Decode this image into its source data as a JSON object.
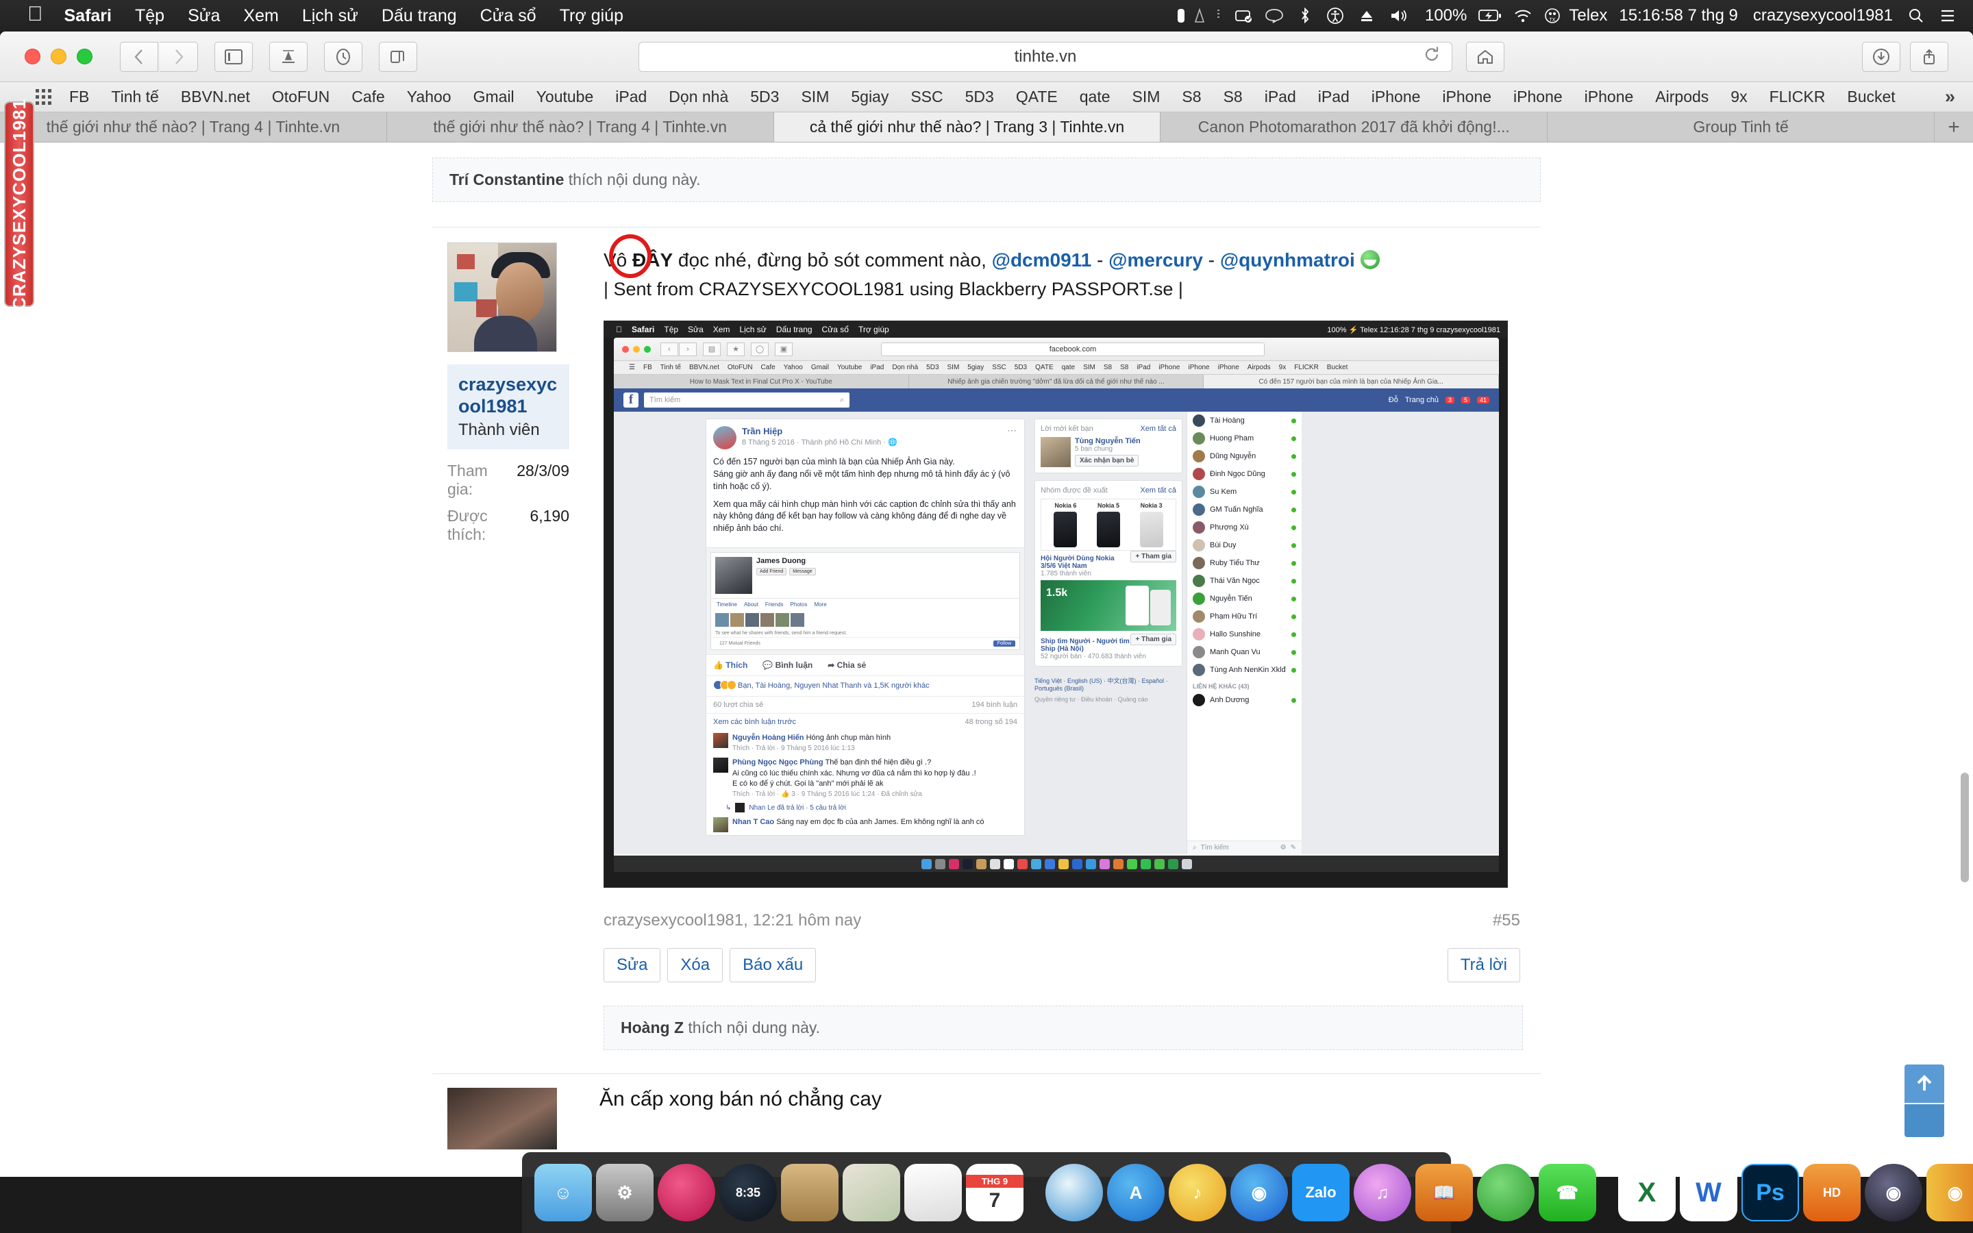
{
  "menubar": {
    "apple": "apple-logo",
    "items": [
      "Safari",
      "Tệp",
      "Sửa",
      "Xem",
      "Lịch sử",
      "Dấu trang",
      "Cửa sổ",
      "Trợ giúp"
    ],
    "battery_percent": "100%",
    "input_source": "Telex",
    "clock": "15:16:58 7 thg 9",
    "user": "crazysexycool1981",
    "right_icons": [
      "lock-icon",
      "signal-icon",
      "notes-icon",
      "chat-icon",
      "bluetooth-icon",
      "accessibility-icon",
      "eject-icon",
      "volume-icon",
      "battery-icon",
      "wifi-icon",
      "keyboard-icon",
      "search-icon",
      "control-center-icon"
    ]
  },
  "toolbar": {
    "url": "tinhte.vn",
    "icons": [
      "back-icon",
      "forward-icon",
      "sidebar-icon",
      "reading-list-icon",
      "history-icon",
      "tabs-icon",
      "reload-icon",
      "download-icon",
      "share-icon",
      "home-icon"
    ]
  },
  "bookmarks": [
    "FB",
    "Tinh tế",
    "BBVN.net",
    "OtoFUN",
    "Cafe",
    "Yahoo",
    "Gmail",
    "Youtube",
    "iPad",
    "Dọn nhà",
    "5D3",
    "SIM",
    "5giay",
    "SSC",
    "5D3",
    "QATE",
    "qate",
    "SIM",
    "S8",
    "S8",
    "iPad",
    "iPad",
    "iPhone",
    "iPhone",
    "iPhone",
    "iPhone",
    "Airpods",
    "9x",
    "FLICKR",
    "Bucket"
  ],
  "bookmarks_overflow": "»",
  "tabs": [
    {
      "label": "thế giới như thế nào? | Trang 4 | Tinhte.vn",
      "active": false
    },
    {
      "label": "thế giới như thế nào? | Trang 4 | Tinhte.vn",
      "active": false
    },
    {
      "label": "cả thế giới như thế nào? | Trang 3 | Tinhte.vn",
      "active": true
    },
    {
      "label": "Canon Photomarathon 2017 đã khởi động!...",
      "active": false
    },
    {
      "label": "Group Tinh tế",
      "active": false
    }
  ],
  "tab_add": "+",
  "sidetab": {
    "label": "CRAZYSEXYCOOL1981"
  },
  "page": {
    "like_notice_top": {
      "user": "Trí Constantine",
      "text": " thích nội dung này."
    },
    "post": {
      "author": "crazysexycool1981",
      "role": "Thành viên",
      "stats": [
        {
          "key": "Tham gia:",
          "value": "28/3/09"
        },
        {
          "key": "Được thích:",
          "value": "6,190"
        }
      ],
      "text_before": "Vô ",
      "text_highlight": "ĐÂY",
      "text_after": " đọc nhé, đừng bỏ sót comment nào, ",
      "mentions": [
        "@dcm0911",
        "@mercury",
        "@quynhmatroi"
      ],
      "mention_sep": " - ",
      "signature": "| Sent from CRAZYSEXYCOOL1981 using Blackberry PASSPORT.se |",
      "meta_left": "crazysexycool1981, 12:21 hôm nay",
      "meta_right": "#55",
      "buttons_left": [
        "Sửa",
        "Xóa",
        "Báo xấu"
      ],
      "button_right": "Trả lời"
    },
    "like_notice_bottom": {
      "user": "Hoàng Z",
      "text": " thích nội dung này."
    },
    "next_post_title": "Ăn cấp xong bán nó chẳng cay"
  },
  "embedded": {
    "menubar_items": [
      "Safari",
      "Tệp",
      "Sửa",
      "Xem",
      "Lịch sử",
      "Dấu trang",
      "Cửa sổ",
      "Trợ giúp"
    ],
    "menubar_right": "100% ⚡   Telex   12:16:28 7 thg 9   crazysexycool1981",
    "url": "facebook.com",
    "bookmarks": [
      "FB",
      "Tinh tế",
      "BBVN.net",
      "OtoFUN",
      "Cafe",
      "Yahoo",
      "Gmail",
      "Youtube",
      "iPad",
      "Dọn nhà",
      "5D3",
      "SIM",
      "5giay",
      "SSC",
      "5D3",
      "QATE",
      "qate",
      "SIM",
      "S8",
      "S8",
      "iPad",
      "iPhone",
      "iPhone",
      "iPhone",
      "Airpods",
      "9x",
      "FLICKR",
      "Bucket"
    ],
    "tabs": [
      "How to Mask Text in Final Cut Pro X - YouTube",
      "Nhiếp ảnh gia chiến trường \"dởm\" đã lừa dối cả thế giới như thế nào ...",
      "Có đến 157 người bạn của mình là bạn của Nhiếp Ảnh Gia..."
    ],
    "fb_search_placeholder": "Tìm kiếm",
    "fb_nav_right": [
      "Đỗ",
      "Trang chủ"
    ],
    "post": {
      "author": "Trần Hiệp",
      "meta": "8 Tháng 5 2016 · Thành phố Hồ Chí Minh · 🌐",
      "paragraphs": [
        "Có đến 157 người bạn của mình là bạn của Nhiếp Ảnh Gia này.\nSáng giờ anh ấy đang nổi về một tấm hình đẹp nhưng mô tả hình đẩy ác ý (vô tình hoặc cố ý).",
        "Xem qua mấy cái hình chụp màn hình với các caption đc chỉnh sửa thì thấy anh này không đáng để kết bạn hay follow và càng không đáng để đi nghe day về nhiếp ảnh báo chí."
      ],
      "inner_name": "James Duong",
      "inner_buttons": [
        "Add Friend",
        "Message"
      ],
      "inner_tabs": [
        "Timeline",
        "About",
        "Friends",
        "Photos",
        "More"
      ],
      "inner_note": "To see what he shares with friends, send him a friend request.",
      "inner_friends": "127 Mutual Friends",
      "inner_follow": "Follow",
      "actions": [
        "Thích",
        "Bình luận",
        "Chia sẻ"
      ],
      "reactions": "Bạn, Tài Hoàng, Nguyen Nhat Thanh và 1,5K người khác",
      "shares": "60 lượt chia sẻ",
      "comments_count": "194 bình luận",
      "see_prev": "Xem các bình luận trước",
      "comment_range": "48 trong số 194",
      "comments": [
        {
          "name": "Nguyễn Hoàng Hiển",
          "text": "Hóng ảnh chụp màn hình",
          "meta": "Thích · Trả lời · 9 Tháng 5 2016 lúc 1:13"
        },
        {
          "name": "Phùng Ngọc Ngọc Phùng",
          "text": "Thế bạn định thể hiện điều gì .?\nAi cũng có lúc thiếu chính xác. Nhưng vơ đũa cả nắm thì ko hợp lý đâu .!\nE có ko để ý chút. Gọi là \"anh\" mới phải lẽ ak",
          "meta": "Thích · Trả lời · 👍 3 · 9 Tháng 5 2016 lúc 1:24 · Đã chỉnh sửa",
          "reply": "Nhan Le đã trả lời · 5 câu trả lời"
        },
        {
          "name": "Nhan T Cao",
          "text": "Sáng nay em đọc fb của anh James. Em không nghĩ là anh có",
          "meta": ""
        }
      ]
    },
    "right_rail": {
      "friend_request_title": "Lời mời kết bạn",
      "see_all": "Xem tất cả",
      "friend_name": "Tùng Nguyễn Tiến",
      "friend_mutual": "5 bạn chung",
      "friend_button": "Xác nhận bạn bè",
      "groups_title": "Nhóm được đề xuất",
      "nokia": [
        "Nokia 6",
        "Nokia 5",
        "Nokia 3"
      ],
      "group1_name": "Hội Người Dùng Nokia 3/5/6 Việt Nam",
      "group1_meta": "1.785 thành viên",
      "group_join": "+ Tham gia",
      "group2_name": "Ship tìm Người - Người tìm Ship (Hà Nội)",
      "group2_meta": "52 người bán · 470.683 thành viên",
      "promo_label": "1.5k",
      "languages": "Tiếng Việt · English (US) · 中文(台灣) · Español · Português (Brasil)",
      "privacy": "Quyền riêng tư · Điều khoản · Quảng cáo"
    },
    "chat": {
      "contacts": [
        "Tài Hoàng",
        "Huong Pham",
        "Dũng Nguyễn",
        "Đinh Ngọc Dũng",
        "Su Kem",
        "GM Tuấn Nghĩa",
        "Phượng Xù",
        "Bùi Duy",
        "Ruby Tiểu Thư",
        "Thái Văn Ngọc",
        "Nguyễn Tiến",
        "Phạm Hữu Trí",
        "Hallo Sunshine",
        "Manh Quan Vu",
        "Tùng Anh NenKin Xklđ"
      ],
      "other_header": "LIÊN HỆ KHÁC (43)",
      "other_contacts": [
        "Anh Dương"
      ],
      "search_placeholder": "Tìm kiếm"
    }
  },
  "dock": {
    "left_apps": [
      "finder-icon",
      "system-preferences-icon",
      "lastpass-icon",
      "clock-widget-icon",
      "contacts-icon",
      "maps-icon",
      "notes-icon",
      "calendar-icon"
    ],
    "calendar_month": "THG 9",
    "calendar_day": "7",
    "mid_apps": [
      "safari-icon",
      "app-store-icon",
      "itunes-match-icon",
      "photos-pro-icon",
      "zalo-icon",
      "itunes-icon",
      "ibooks-icon",
      "chrome-variant-icon",
      "messages-icon",
      "x-icon",
      "word-icon",
      "photoshop-icon",
      "handbrake-icon",
      "film-icon",
      "viewer-icon",
      "calibre-icon",
      "repixpro-icon",
      "final-cut-pro-icon"
    ],
    "right_apps": [
      "downloads-icon",
      "documents-icon",
      "airdrop-icon",
      "pdf-converter-icon",
      "green-circle-icon",
      "trash-icon"
    ]
  },
  "colors": {
    "accent_blue": "#1a5fa8",
    "fb_blue": "#3b5998",
    "highlight_red": "#e01b1b",
    "tab_red": "#c9302c"
  }
}
